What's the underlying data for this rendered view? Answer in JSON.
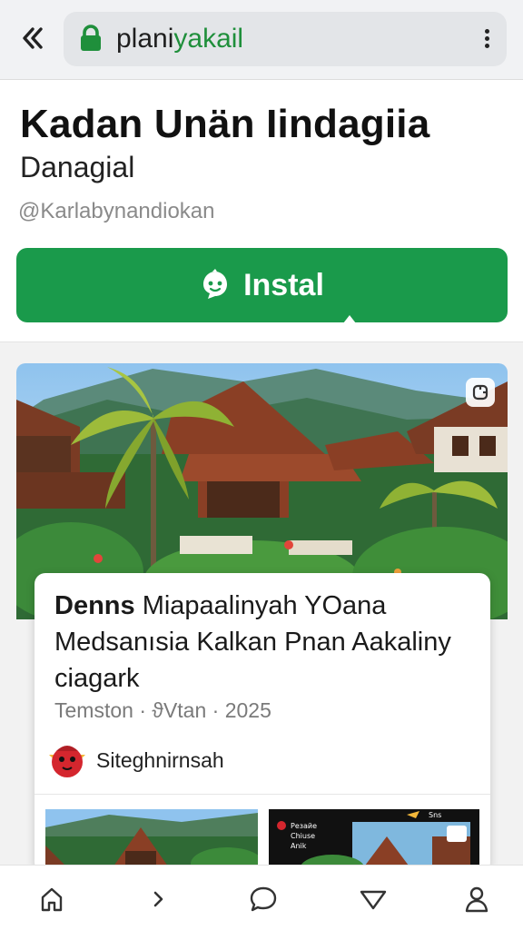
{
  "browser": {
    "url_prefix": "plani",
    "url_domain": "yakail",
    "icons": [
      "back-double-chevron-icon",
      "lock-icon",
      "kebab-menu-icon"
    ]
  },
  "app": {
    "title": "Kadan Unän Iindagiia",
    "subtitle": "Danagial",
    "handle": "@Karlabynandiokan",
    "install_label": "Instal",
    "accent": "#1a9a4b"
  },
  "article": {
    "headline_bold": "Denns",
    "headline_rest": " Miapaalinyah YOana Medsanısia Kalkan Pnan Aakaliny ciagark",
    "meta": "Temston · ϑVtan · 2025",
    "author": "Siteghnirnsah"
  },
  "thumb2_text": {
    "line1": "Резайе",
    "line2": "Chiuse",
    "line3": "Anik",
    "badge": "Sns"
  },
  "nav": {
    "items": [
      "home-icon",
      "forward-chevron-icon",
      "chat-bubble-icon",
      "triangle-down-icon",
      "profile-icon"
    ]
  }
}
